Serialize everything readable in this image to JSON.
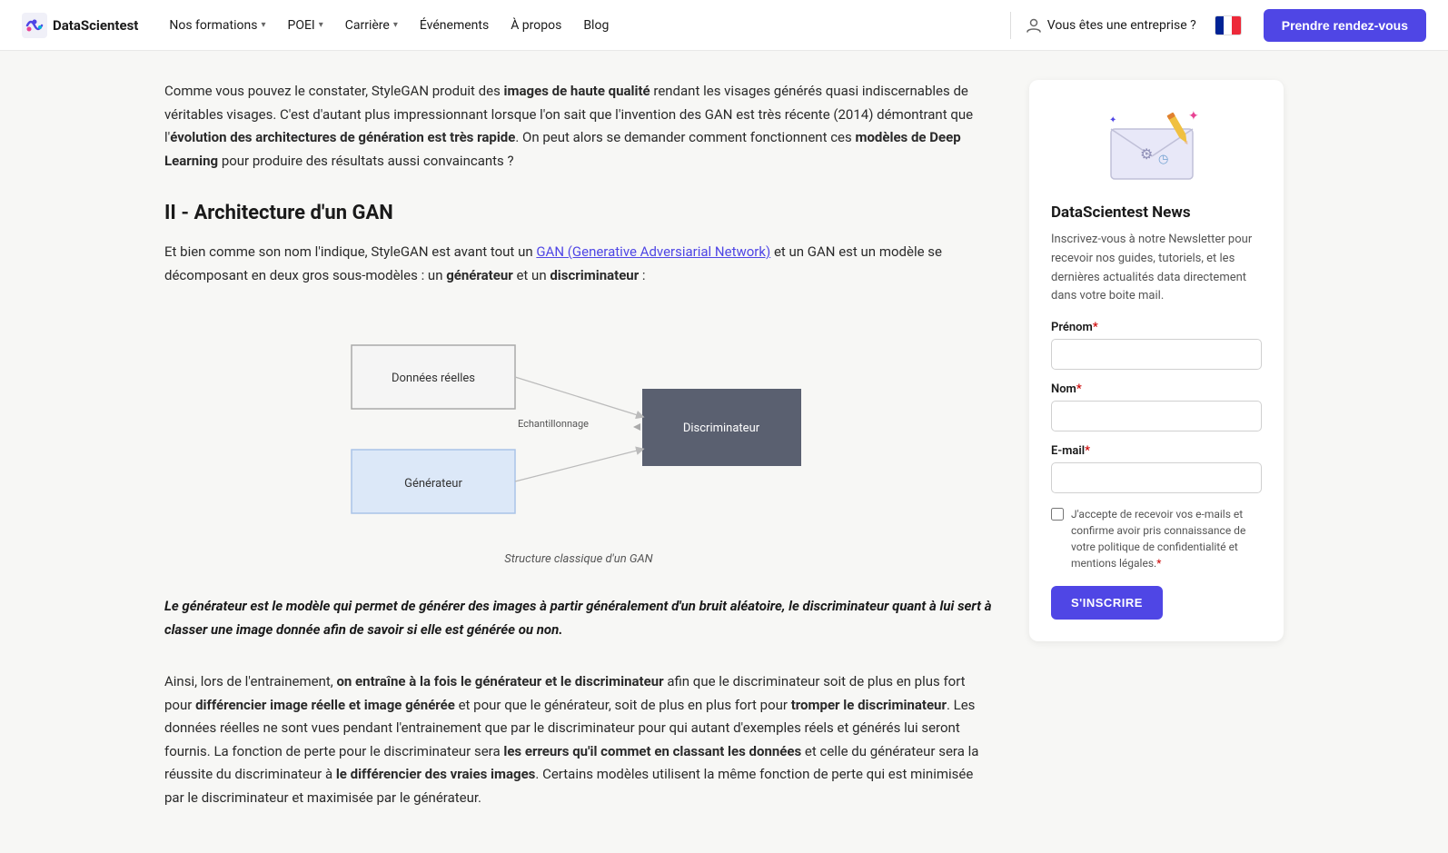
{
  "navbar": {
    "logo_text": "DataScientest",
    "nav_items": [
      {
        "label": "Nos formations",
        "has_dropdown": true
      },
      {
        "label": "POEI",
        "has_dropdown": true
      },
      {
        "label": "Carrière",
        "has_dropdown": true
      },
      {
        "label": "Événements",
        "has_dropdown": false
      },
      {
        "label": "À propos",
        "has_dropdown": false
      },
      {
        "label": "Blog",
        "has_dropdown": false
      }
    ],
    "enterprise_label": "Vous êtes une entreprise ?",
    "cta_label": "Prendre rendez-vous"
  },
  "main": {
    "intro_paragraph": "Comme vous pouvez le constater, StyleGAN produit des images de haute qualité rendant les visages générés quasi indiscernables de véritables visages. C'est d'autant plus impressionnant lorsque l'on sait que l'invention des GAN est très récente (2014) démontrant que l'évolution des architectures de génération est très rapide. On peut alors se demander comment fonctionnent ces modèles de Deep Learning pour produire des résultats aussi convaincants ?",
    "section_heading": "II - Architecture d'un GAN",
    "section_intro": "Et bien comme son nom l'indique, StyleGAN est avant tout un GAN (Generative Adversiarial Network) et un GAN est un modèle se décomposant en deux gros sous-modèles : un générateur et un discriminateur :",
    "link_text": "GAN (Generative Adversiarial Network)",
    "diagram": {
      "box_donnees": "Données réelles",
      "box_generateur": "Générateur",
      "box_discriminateur": "Discriminateur",
      "echantillonnage_label": "Echantillonnage",
      "caption": "Structure classique d'un GAN"
    },
    "quote_text": "Le générateur est le modèle qui permet de générer des images à partir généralement d'un bruit aléatoire, le discriminateur quant à lui sert à classer une image donnée afin de savoir si elle est générée ou non.",
    "body_paragraph": "Ainsi, lors de l'entrainement, on entraîne à la fois le générateur et le discriminateur afin que le discriminateur soit de plus en plus fort pour différencier image réelle et image générée et pour que le générateur, soit de plus en plus fort pour tromper le discriminateur. Les données réelles ne sont vues pendant l'entrainement que par le discriminateur pour qui autant d'exemples réels et générés lui seront fournis. La fonction de perte pour le discriminateur sera les erreurs qu'il commet en classant les données et celle du générateur sera la réussite du discriminateur à le différencier des vraies images. Certains modèles utilisent la même fonction de perte qui est minimisée par le discriminateur et maximisée par le générateur."
  },
  "sidebar": {
    "title": "DataScientest News",
    "description": "Inscrivez-vous à notre Newsletter pour recevoir nos guides, tutoriels, et les dernières actualités data directement dans votre boite mail.",
    "form": {
      "prenom_label": "Prénom",
      "prenom_required": "*",
      "nom_label": "Nom",
      "nom_required": "*",
      "email_label": "E-mail",
      "email_required": "*",
      "checkbox_label": "J'accepte de recevoir vos e-mails et confirme avoir pris connaissance de votre politique de confidentialité et mentions légales.",
      "checkbox_required": "*",
      "submit_label": "S'INSCRIRE"
    }
  }
}
